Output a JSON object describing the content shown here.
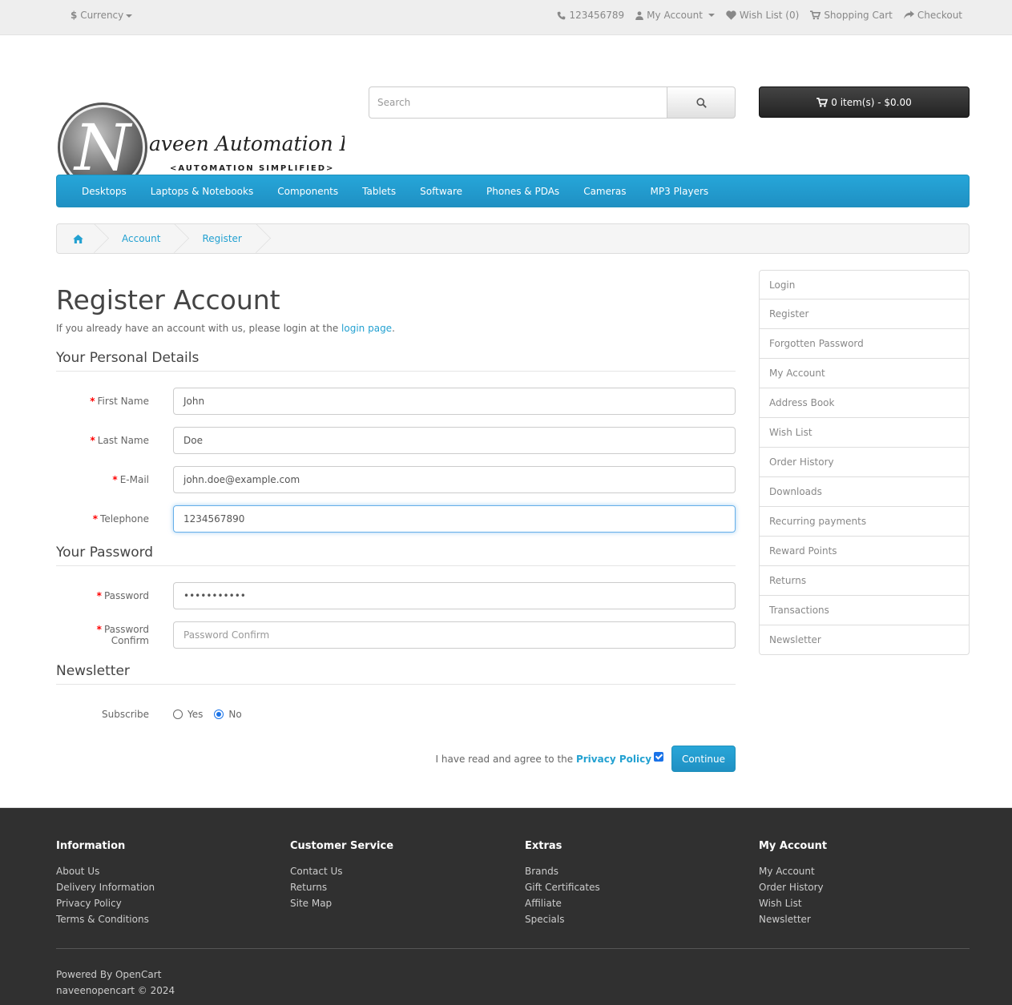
{
  "topbar": {
    "currency_label": "Currency",
    "phone": "123456789",
    "my_account": "My Account",
    "wish_list": "Wish List (0)",
    "shopping_cart": "Shopping Cart",
    "checkout": "Checkout"
  },
  "header": {
    "logo_brand": "aveen Automation Labs",
    "logo_tagline": "<AUTOMATION SIMPLIFIED>",
    "search_placeholder": "Search",
    "cart_label": "0 item(s) - $0.00"
  },
  "menu": [
    "Desktops",
    "Laptops & Notebooks",
    "Components",
    "Tablets",
    "Software",
    "Phones & PDAs",
    "Cameras",
    "MP3 Players"
  ],
  "breadcrumb": [
    "Account",
    "Register"
  ],
  "page": {
    "title": "Register Account",
    "intro_text": "If you already have an account with us, please login at the ",
    "intro_link": "login page",
    "intro_end": "."
  },
  "personal": {
    "legend": "Your Personal Details",
    "first_name_label": "First Name",
    "first_name_value": "John",
    "last_name_label": "Last Name",
    "last_name_value": "Doe",
    "email_label": "E-Mail",
    "email_value": "john.doe@example.com",
    "telephone_label": "Telephone",
    "telephone_value": "1234567890"
  },
  "password": {
    "legend": "Your Password",
    "password_label": "Password",
    "password_value": "•••••••••••",
    "confirm_label": "Password Confirm",
    "confirm_placeholder": "Password Confirm"
  },
  "newsletter": {
    "legend": "Newsletter",
    "subscribe_label": "Subscribe",
    "yes": "Yes",
    "no": "No",
    "selected": "No"
  },
  "agree": {
    "text": "I have read and agree to the ",
    "link": "Privacy Policy",
    "checked": true,
    "continue": "Continue"
  },
  "sidebar": [
    "Login",
    "Register",
    "Forgotten Password",
    "My Account",
    "Address Book",
    "Wish List",
    "Order History",
    "Downloads",
    "Recurring payments",
    "Reward Points",
    "Returns",
    "Transactions",
    "Newsletter"
  ],
  "footer": {
    "information": {
      "title": "Information",
      "links": [
        "About Us",
        "Delivery Information",
        "Privacy Policy",
        "Terms & Conditions"
      ]
    },
    "customer_service": {
      "title": "Customer Service",
      "links": [
        "Contact Us",
        "Returns",
        "Site Map"
      ]
    },
    "extras": {
      "title": "Extras",
      "links": [
        "Brands",
        "Gift Certificates",
        "Affiliate",
        "Specials"
      ]
    },
    "my_account": {
      "title": "My Account",
      "links": [
        "My Account",
        "Order History",
        "Wish List",
        "Newsletter"
      ]
    },
    "powered_prefix": "Powered By ",
    "powered_link": "OpenCart",
    "copyright": "naveenopencart © 2024"
  },
  "colors": {
    "accent": "#23a1d1",
    "menu": "#229ac8",
    "footer_bg": "#303030",
    "required": "#ff0000"
  }
}
